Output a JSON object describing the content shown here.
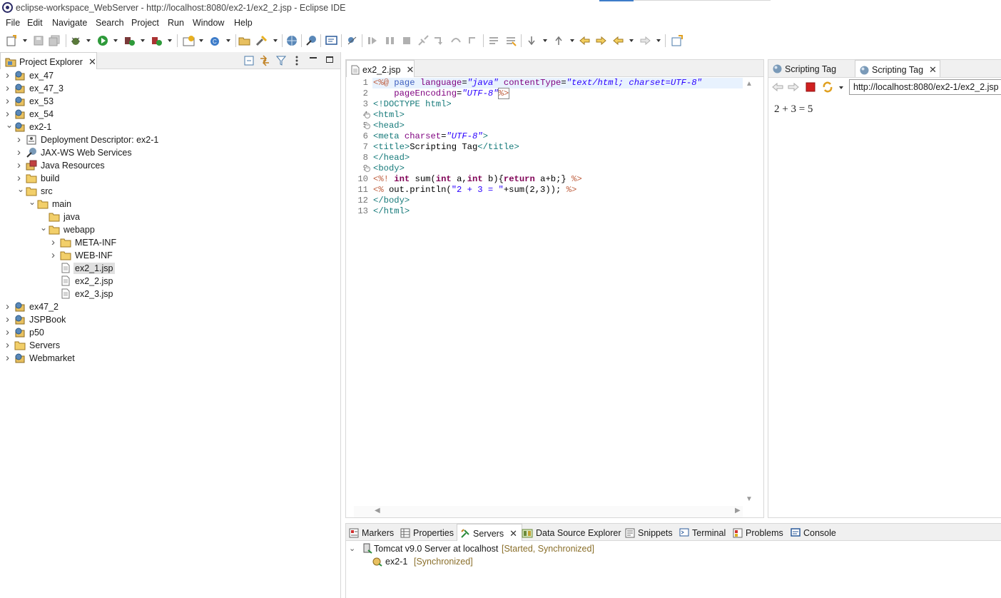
{
  "window": {
    "title": "eclipse-workspace_WebServer - http://localhost:8080/ex2-1/ex2_2.jsp - Eclipse IDE"
  },
  "menu": [
    "File",
    "Edit",
    "Navigate",
    "Search",
    "Project",
    "Run",
    "Window",
    "Help"
  ],
  "project_explorer": {
    "tab_label": "Project Explorer",
    "tree": [
      {
        "label": "ex_47",
        "depth": 0,
        "expanded": false,
        "icon": "project-icon"
      },
      {
        "label": "ex_47_3",
        "depth": 0,
        "expanded": false,
        "icon": "project-icon"
      },
      {
        "label": "ex_53",
        "depth": 0,
        "expanded": false,
        "icon": "project-icon"
      },
      {
        "label": "ex_54",
        "depth": 0,
        "expanded": false,
        "icon": "project-icon"
      },
      {
        "label": "ex2-1",
        "depth": 0,
        "expanded": true,
        "icon": "project-icon"
      },
      {
        "label": "Deployment Descriptor: ex2-1",
        "depth": 1,
        "expanded": false,
        "icon": "deployment-descriptor-icon"
      },
      {
        "label": "JAX-WS Web Services",
        "depth": 1,
        "expanded": false,
        "icon": "web-services-icon"
      },
      {
        "label": "Java Resources",
        "depth": 1,
        "expanded": false,
        "icon": "java-resources-icon"
      },
      {
        "label": "build",
        "depth": 1,
        "expanded": false,
        "icon": "folder-icon"
      },
      {
        "label": "src",
        "depth": 1,
        "expanded": true,
        "icon": "folder-icon"
      },
      {
        "label": "main",
        "depth": 2,
        "expanded": true,
        "icon": "folder-icon"
      },
      {
        "label": "java",
        "depth": 3,
        "expanded": null,
        "icon": "folder-icon"
      },
      {
        "label": "webapp",
        "depth": 3,
        "expanded": true,
        "icon": "folder-icon"
      },
      {
        "label": "META-INF",
        "depth": 4,
        "expanded": false,
        "icon": "folder-icon"
      },
      {
        "label": "WEB-INF",
        "depth": 4,
        "expanded": false,
        "icon": "folder-icon"
      },
      {
        "label": "ex2_1.jsp",
        "depth": 4,
        "expanded": null,
        "icon": "jsp-file-icon",
        "selected": true
      },
      {
        "label": "ex2_2.jsp",
        "depth": 4,
        "expanded": null,
        "icon": "jsp-file-icon"
      },
      {
        "label": "ex2_3.jsp",
        "depth": 4,
        "expanded": null,
        "icon": "jsp-file-icon"
      },
      {
        "label": "ex47_2",
        "depth": 0,
        "expanded": false,
        "icon": "project-icon"
      },
      {
        "label": "JSPBook",
        "depth": 0,
        "expanded": false,
        "icon": "project-icon"
      },
      {
        "label": "p50",
        "depth": 0,
        "expanded": false,
        "icon": "project-icon"
      },
      {
        "label": "Servers",
        "depth": 0,
        "expanded": false,
        "icon": "folder-icon"
      },
      {
        "label": "Webmarket",
        "depth": 0,
        "expanded": false,
        "icon": "project-icon"
      }
    ]
  },
  "editor": {
    "tab_label": "ex2_2.jsp",
    "lines": [
      {
        "n": "1",
        "fold": false
      },
      {
        "n": "2",
        "fold": false
      },
      {
        "n": "3",
        "fold": false
      },
      {
        "n": "4",
        "fold": true
      },
      {
        "n": "5",
        "fold": true
      },
      {
        "n": "6",
        "fold": false
      },
      {
        "n": "7",
        "fold": false
      },
      {
        "n": "8",
        "fold": false
      },
      {
        "n": "9",
        "fold": true
      },
      {
        "n": "10",
        "fold": false
      },
      {
        "n": "11",
        "fold": false
      },
      {
        "n": "12",
        "fold": false
      },
      {
        "n": "13",
        "fold": false
      }
    ],
    "code": {
      "l1a": "<%@ ",
      "l1b": "page ",
      "l1c": "language",
      "l1d": "=",
      "l1e": "\"java\"",
      "l1f": " contentType",
      "l1g": "=",
      "l1h": "\"text/html; charset=UTF-8\"",
      "l2a": "    pageEncoding",
      "l2b": "=",
      "l2c": "\"UTF-8\"",
      "l2d": "%>",
      "l3": "<!DOCTYPE html>",
      "l4": "<html>",
      "l5": "<head>",
      "l6a": "<meta ",
      "l6b": "charset",
      "l6c": "=",
      "l6d": "\"UTF-8\"",
      "l6e": ">",
      "l7a": "<title>",
      "l7b": "Scripting Tag",
      "l7c": "</title>",
      "l8": "</head>",
      "l9": "<body>",
      "l10a": "<%! ",
      "l10b": "int",
      "l10c": " sum(",
      "l10d": "int",
      "l10e": " a,",
      "l10f": "int",
      "l10g": " b){",
      "l10h": "return",
      "l10i": " a+b;} ",
      "l10j": "%>",
      "l11a": "<% ",
      "l11b": "out.println(",
      "l11c": "\"2 + 3 = \"",
      "l11d": "+sum(2,3)); ",
      "l11e": "%>",
      "l12": "</body>",
      "l13": "</html>"
    }
  },
  "browser": {
    "tab1_label": "Scripting Tag",
    "tab2_label": "Scripting Tag",
    "url": "http://localhost:8080/ex2-1/ex2_2.jsp",
    "content": "2 + 3 = 5"
  },
  "bottom_panel": {
    "tabs": [
      "Markers",
      "Properties",
      "Servers",
      "Data Source Explorer",
      "Snippets",
      "Terminal",
      "Problems",
      "Console"
    ],
    "active_tab": "Servers",
    "server": {
      "name": "Tomcat v9.0 Server at localhost",
      "status": "[Started, Synchronized]"
    },
    "module": {
      "name": "ex2-1",
      "status": "[Synchronized]"
    }
  },
  "colors": {
    "accent": "#3d7cc9",
    "tag": "#167a7a",
    "keyword": "#7f0055",
    "string": "#2a00ff",
    "status": "#8a6f2a"
  }
}
